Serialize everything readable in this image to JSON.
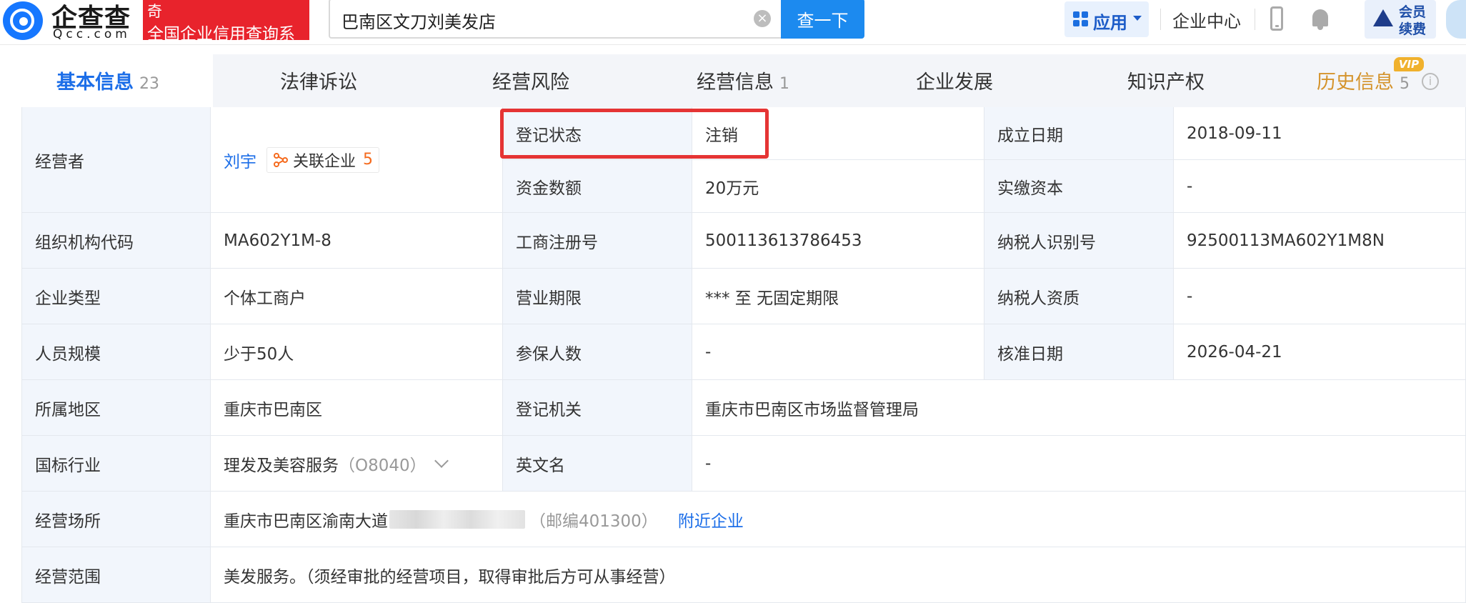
{
  "header": {
    "logo_name": "企查查",
    "logo_domain": "Qcc.com",
    "slogan_top": "奇",
    "slogan_bottom": "全国企业信用查询系",
    "search_value": "巴南区文刀刘美发店",
    "search_button": "查一下",
    "apps_label": "应用",
    "enterprise_center": "企业中心",
    "vip_line1": "会员",
    "vip_line2": "续费"
  },
  "tabs": [
    {
      "label": "基本信息",
      "count": "23"
    },
    {
      "label": "法律诉讼",
      "count": ""
    },
    {
      "label": "经营风险",
      "count": ""
    },
    {
      "label": "经营信息",
      "count": "1"
    },
    {
      "label": "企业发展",
      "count": ""
    },
    {
      "label": "知识产权",
      "count": ""
    },
    {
      "label": "历史信息",
      "count": "5",
      "badge": "VIP"
    }
  ],
  "info": {
    "operator_label": "经营者",
    "operator_name": "刘宇",
    "related_label": "关联企业",
    "related_count": "5",
    "reg_status_label": "登记状态",
    "reg_status_value": "注销",
    "established_label": "成立日期",
    "established_value": "2018-09-11",
    "capital_label": "资金数额",
    "capital_value": "20万元",
    "paid_capital_label": "实缴资本",
    "paid_capital_value": "-",
    "org_code_label": "组织机构代码",
    "org_code_value": "MA602Y1M-8",
    "biz_reg_no_label": "工商注册号",
    "biz_reg_no_value": "500113613786453",
    "taxpayer_id_label": "纳税人识别号",
    "taxpayer_id_value": "92500113MA602Y1M8N",
    "company_type_label": "企业类型",
    "company_type_value": "个体工商户",
    "biz_period_label": "营业期限",
    "biz_period_value": "*** 至 无固定期限",
    "taxpayer_qual_label": "纳税人资质",
    "taxpayer_qual_value": "-",
    "staff_size_label": "人员规模",
    "staff_size_value": "少于50人",
    "insured_label": "参保人数",
    "insured_value": "-",
    "approval_date_label": "核准日期",
    "approval_date_value": "2026-04-21",
    "region_label": "所属地区",
    "region_value": "重庆市巴南区",
    "reg_authority_label": "登记机关",
    "reg_authority_value": "重庆市巴南区市场监督管理局",
    "industry_label": "国标行业",
    "industry_value": "理发及美容服务",
    "industry_code": "（O8040）",
    "english_name_label": "英文名",
    "english_name_value": "-",
    "address_label": "经营场所",
    "address_value": "重庆市巴南区渝南大道",
    "postcode": "（邮编401300）",
    "nearby_link": "附近企业",
    "scope_label": "经营范围",
    "scope_value": "美发服务。（须经审批的经营项目，取得审批后方可从事经营）"
  },
  "colors": {
    "accent_blue": "#1c6ee8",
    "brand_red": "#e8232c",
    "highlight_red": "#e53434",
    "label_bg": "#f2f6fc"
  }
}
